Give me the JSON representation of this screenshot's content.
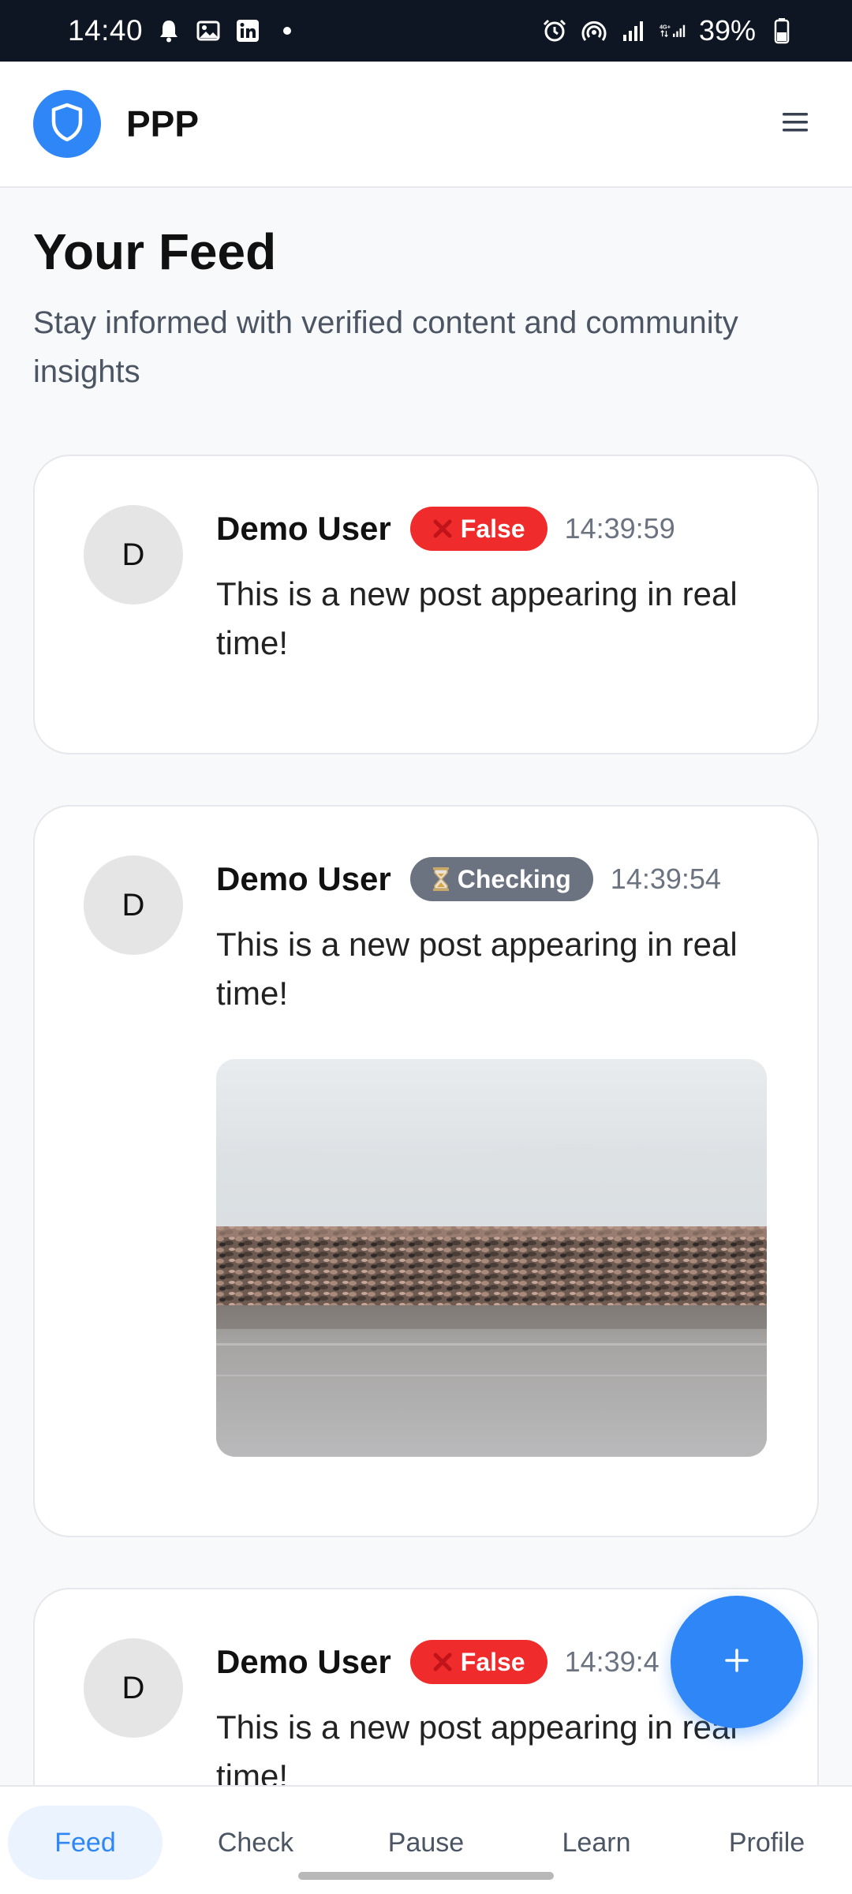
{
  "status_bar": {
    "time": "14:40",
    "battery": "39%",
    "left_icons": [
      "bell-icon",
      "image-icon",
      "linkedin-icon",
      "dot-icon"
    ],
    "right_icons": [
      "alarm-icon",
      "hotspot-icon",
      "signal-icon",
      "4g-signal-icon",
      "battery-icon"
    ]
  },
  "header": {
    "title": "PPP",
    "logo_icon": "shield-icon",
    "menu_icon": "hamburger-menu-icon",
    "accent_color": "#2f86f6"
  },
  "page": {
    "title": "Your Feed",
    "subtitle": "Stay informed with verified content and community insights"
  },
  "posts": [
    {
      "avatar": "D",
      "author": "Demo User",
      "badge": {
        "label": "False",
        "type": "false",
        "icon": "x-icon",
        "color": "#ef2b2b"
      },
      "time": "14:39:59",
      "text": "This is a new post appearing in real time!"
    },
    {
      "avatar": "D",
      "author": "Demo User",
      "badge": {
        "label": "Checking",
        "type": "checking",
        "icon": "hourglass-icon",
        "color": "#6b7280"
      },
      "time": "14:39:54",
      "text": "This is a new post appearing in real time!",
      "image": "rocky-shoreline-photo"
    },
    {
      "avatar": "D",
      "author": "Demo User",
      "badge": {
        "label": "False",
        "type": "false",
        "icon": "x-icon",
        "color": "#ef2b2b"
      },
      "time": "14:39:4",
      "text": "This is a new post appearing in real time!"
    }
  ],
  "fab": {
    "icon": "plus-icon"
  },
  "bottom_nav": {
    "items": [
      "Feed",
      "Check",
      "Pause",
      "Learn",
      "Profile"
    ],
    "active": "Feed"
  }
}
